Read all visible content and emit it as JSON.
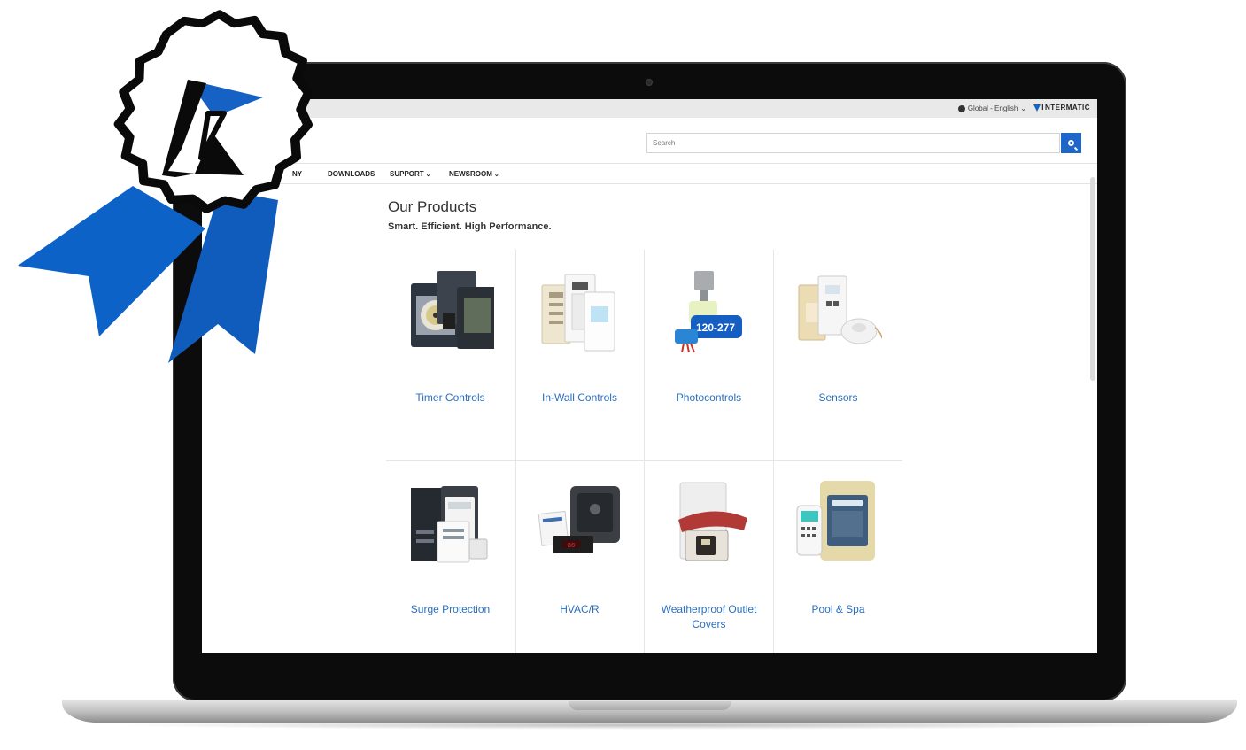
{
  "topbar": {
    "region_label": "Global - English",
    "chevron": "⌄",
    "brand_initial": "I",
    "brand_name": "NTERMATIC"
  },
  "search": {
    "placeholder": "Search",
    "icon": "search-icon",
    "accent": "#1e66c9"
  },
  "nav": {
    "items": [
      {
        "label": "NY",
        "has_chevron": false
      },
      {
        "label": "DOWNLOADS",
        "has_chevron": false
      },
      {
        "label": "SUPPORT",
        "has_chevron": true
      },
      {
        "label": "NEWSROOM",
        "has_chevron": true
      }
    ],
    "chevron": "⌄"
  },
  "main": {
    "title": "Our Products",
    "subtitle": "Smart. Efficient. High Performance.",
    "products": [
      {
        "label": "Timer Controls",
        "icon": "timer-controls-icon"
      },
      {
        "label": "In-Wall Controls",
        "icon": "in-wall-controls-icon"
      },
      {
        "label": "Photocontrols",
        "icon": "photocontrols-icon",
        "image_text": "120-277"
      },
      {
        "label": "Sensors",
        "icon": "sensors-icon"
      },
      {
        "label": "Surge Protection",
        "icon": "surge-protection-icon"
      },
      {
        "label": "HVAC/R",
        "icon": "hvac-icon"
      },
      {
        "label": "Weatherproof Outlet Covers",
        "icon": "outlet-cover-icon"
      },
      {
        "label": "Pool & Spa",
        "icon": "pool-spa-icon"
      }
    ],
    "link_color": "#2b6fc0"
  },
  "badge": {
    "icon": "award-ribbon-icon",
    "ribbon_color": "#0d62c7"
  }
}
